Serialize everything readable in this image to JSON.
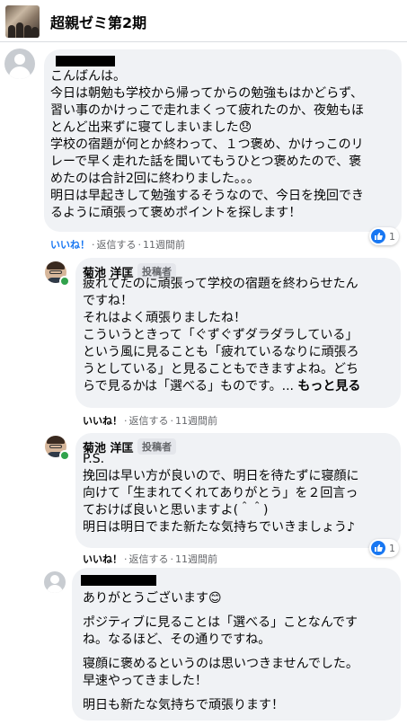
{
  "group": {
    "title": "超親ゼミ第2期"
  },
  "comments": [
    {
      "lines": [
        "こんばんは。",
        "今日は朝勉も学校から帰ってからの勉強もはかどらず、",
        "習い事のかけっこで走れまくって疲れたのか、夜勉もほ",
        "とんど出来ずに寝てしまいました😞",
        "学校の宿題が何とか終わって、１つ褒め、かけっこのリ",
        "レーで早く走れた話を聞いてもうひとつ褒めたので、褒",
        "めたのは合計2回に終わりました。。。",
        "明日は早起きして勉強するそうなので、今日を挽回でき",
        "るように頑張って褒めポイントを探します！"
      ],
      "like": "いいね！",
      "reply": "返信する",
      "time": "11週間前",
      "reaction_count": "1"
    },
    {
      "author": "菊池 洋匡",
      "badge": "投稿者",
      "lines": [
        "疲れてたのに頑張って学校の宿題を終わらせたん",
        "ですね！",
        "それはよく頑張りましたね！",
        "こういうときって「ぐずぐずダラダラしている」",
        "という風に見ることも「疲れているなりに頑張ろ",
        "うとしている」と見ることもできますよね。どち"
      ],
      "last_line": "らで見るかは「選べる」ものです。... ",
      "more": "もっと見る",
      "like": "いいね！",
      "reply": "返信する",
      "time": "11週間前"
    },
    {
      "author": "菊池 洋匡",
      "badge": "投稿者",
      "lines": [
        "P.S.",
        "挽回は早い方が良いので、明日を待たずに寝顔に",
        "向けて「生まれてくれてありがとう」を２回言っ",
        "ておけば良いと思いますよ(＾＾)",
        "明日は明日でまた新たな気持ちでいきましょう♪"
      ],
      "like": "いいね！",
      "reply": "返信する",
      "time": "11週間前",
      "reaction_count": "1"
    },
    {
      "paragraphs": [
        [
          "ありがとうございます😊"
        ],
        [
          "ポジティブに見ることは「選べる」ことなんです",
          "ね。なるほど、その通りですね。"
        ],
        [
          "寝顔に褒めるというのは思いつきませんでした。",
          "早速やってきました！"
        ],
        [
          "明日も新たな気持ちで頑張ります！"
        ]
      ]
    }
  ]
}
